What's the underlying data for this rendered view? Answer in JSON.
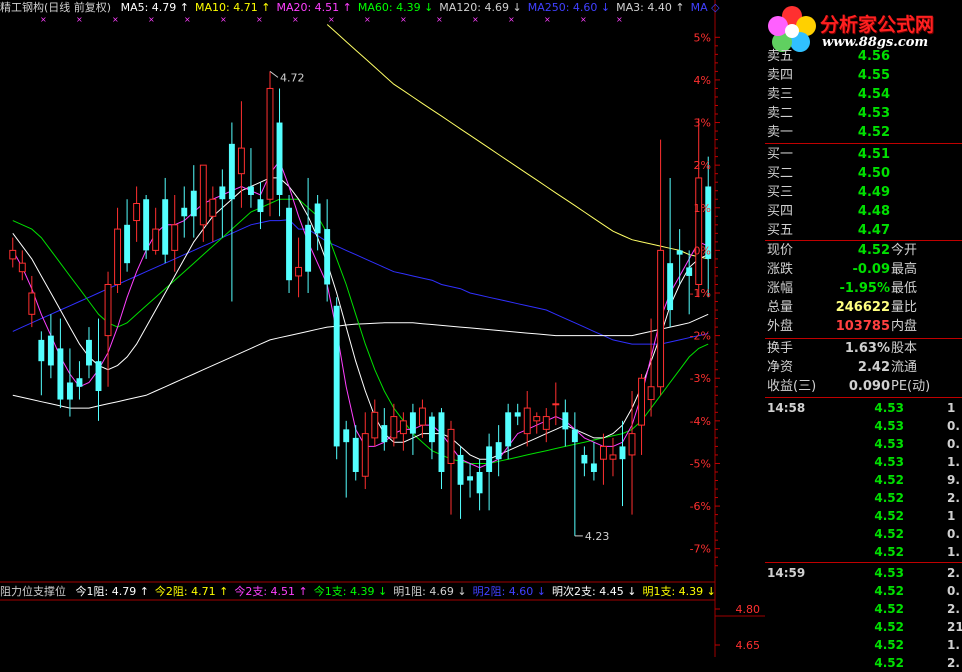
{
  "header": {
    "title": "精工钢构(日线 前复权)",
    "ma": [
      {
        "label": "MA5: 4.79",
        "arrow": "↑",
        "color": "#ffffff"
      },
      {
        "label": "MA10: 4.71",
        "arrow": "↑",
        "color": "#ffff00"
      },
      {
        "label": "MA20: 4.51",
        "arrow": "↑",
        "color": "#ff40ff"
      },
      {
        "label": "MA60: 4.39",
        "arrow": "↓",
        "color": "#00ff00"
      },
      {
        "label": "MA120: 4.69",
        "arrow": "↓",
        "color": "#d0d0d0"
      },
      {
        "label": "MA250: 4.60",
        "arrow": "↓",
        "color": "#4040ff"
      },
      {
        "label": "MA3: 4.40",
        "arrow": "↑",
        "color": "#d0d0d0"
      },
      {
        "label": "MA",
        "arrow": "◇",
        "color": "#4040ff"
      }
    ]
  },
  "price_axis": [
    "5%",
    "4%",
    "3%",
    "2%",
    "1%",
    "0%",
    "-1%",
    "-2%",
    "-3%",
    "-4%",
    "-5%",
    "-6%",
    "-7%"
  ],
  "annotations": {
    "high": "4.72",
    "low": "4.23"
  },
  "sub_header": {
    "title": "阻力位支撑位",
    "items": [
      {
        "label": "今1阻: 4.79",
        "arrow": "↑",
        "color": "#ffffff"
      },
      {
        "label": "今2阻: 4.71",
        "arrow": "↑",
        "color": "#ffff00"
      },
      {
        "label": "今2支: 4.51",
        "arrow": "↑",
        "color": "#ff40ff"
      },
      {
        "label": "今1支: 4.39",
        "arrow": "↓",
        "color": "#00ff00"
      },
      {
        "label": "明1阻: 4.69",
        "arrow": "↓",
        "color": "#d0d0d0"
      },
      {
        "label": "明2阻: 4.60",
        "arrow": "↓",
        "color": "#4040ff"
      },
      {
        "label": "明次2支: 4.45",
        "arrow": "↓",
        "color": "#ffffff"
      },
      {
        "label": "明1支: 4.39",
        "arrow": "↓",
        "color": "#ffff00"
      }
    ]
  },
  "sub_axis": [
    "4.80",
    "4.65"
  ],
  "logo": {
    "text": "分析家公式网",
    "url": "www.88gs.com"
  },
  "quote": {
    "asks": [
      {
        "label": "卖五",
        "value": "4.56"
      },
      {
        "label": "卖四",
        "value": "4.55"
      },
      {
        "label": "卖三",
        "value": "4.54"
      },
      {
        "label": "卖二",
        "value": "4.53"
      },
      {
        "label": "卖一",
        "value": "4.52"
      }
    ],
    "bids": [
      {
        "label": "买一",
        "value": "4.51"
      },
      {
        "label": "买二",
        "value": "4.50"
      },
      {
        "label": "买三",
        "value": "4.49"
      },
      {
        "label": "买四",
        "value": "4.48"
      },
      {
        "label": "买五",
        "value": "4.47"
      }
    ],
    "stats": [
      {
        "label": "现价",
        "value": "4.52",
        "label2": "今开",
        "color": "#00e000"
      },
      {
        "label": "涨跌",
        "value": "-0.09",
        "label2": "最高",
        "color": "#00e000"
      },
      {
        "label": "涨幅",
        "value": "-1.95%",
        "label2": "最低",
        "color": "#00e000"
      },
      {
        "label": "总量",
        "value": "246622",
        "label2": "量比",
        "color": "#ffff80"
      },
      {
        "label": "外盘",
        "value": "103785",
        "label2": "内盘",
        "color": "#ff4040"
      }
    ],
    "stats2": [
      {
        "label": "换手",
        "value": "1.63%",
        "label2": "股本",
        "color": "#d0d0d0"
      },
      {
        "label": "净资",
        "value": "2.42",
        "label2": "流通",
        "color": "#d0d0d0"
      },
      {
        "label": "收益(三)",
        "value": "0.090",
        "label2": "PE(动)",
        "color": "#d0d0d0"
      }
    ]
  },
  "ticks": [
    {
      "time": "14:58",
      "price": "4.53",
      "vol": "1"
    },
    {
      "time": "",
      "price": "4.53",
      "vol": "0."
    },
    {
      "time": "",
      "price": "4.53",
      "vol": "0."
    },
    {
      "time": "",
      "price": "4.53",
      "vol": "1."
    },
    {
      "time": "",
      "price": "4.52",
      "vol": "9."
    },
    {
      "time": "",
      "price": "4.52",
      "vol": "2."
    },
    {
      "time": "",
      "price": "4.52",
      "vol": "1"
    },
    {
      "time": "",
      "price": "4.52",
      "vol": "0."
    },
    {
      "time": "",
      "price": "4.52",
      "vol": "1."
    },
    {
      "time": "14:59",
      "price": "4.53",
      "vol": "2."
    },
    {
      "time": "",
      "price": "4.52",
      "vol": "0."
    },
    {
      "time": "",
      "price": "4.52",
      "vol": "2."
    },
    {
      "time": "",
      "price": "4.52",
      "vol": "21."
    },
    {
      "time": "",
      "price": "4.52",
      "vol": "1."
    },
    {
      "time": "",
      "price": "4.52",
      "vol": "2."
    }
  ],
  "chart_data": {
    "type": "candlestick",
    "y_unit": "%",
    "ylim": [
      -7.5,
      5.5
    ],
    "candles": [
      {
        "o": -0.2,
        "c": 0.0,
        "h": 0.3,
        "l": -0.4
      },
      {
        "o": -0.5,
        "c": -0.3,
        "h": 0.0,
        "l": -0.7
      },
      {
        "o": -1.5,
        "c": -1.0,
        "h": -0.6,
        "l": -1.8
      },
      {
        "o": -2.1,
        "c": -2.6,
        "h": -1.9,
        "l": -3.4
      },
      {
        "o": -2.0,
        "c": -2.7,
        "h": -1.5,
        "l": -3.0
      },
      {
        "o": -2.3,
        "c": -3.5,
        "h": -1.6,
        "l": -3.7
      },
      {
        "o": -3.1,
        "c": -3.5,
        "h": -2.3,
        "l": -3.9
      },
      {
        "o": -3.0,
        "c": -3.2,
        "h": -2.6,
        "l": -3.5
      },
      {
        "o": -2.1,
        "c": -2.7,
        "h": -1.8,
        "l": -3.0
      },
      {
        "o": -2.6,
        "c": -3.3,
        "h": -1.6,
        "l": -4.0
      },
      {
        "o": -2.0,
        "c": -0.8,
        "h": -0.5,
        "l": -3.2
      },
      {
        "o": -0.8,
        "c": 0.5,
        "h": 1.0,
        "l": -1.0
      },
      {
        "o": 0.6,
        "c": -0.3,
        "h": 1.2,
        "l": -0.5
      },
      {
        "o": 0.7,
        "c": 1.1,
        "h": 1.5,
        "l": 0.2
      },
      {
        "o": 1.2,
        "c": 0.0,
        "h": 1.3,
        "l": -0.2
      },
      {
        "o": 0.0,
        "c": 0.5,
        "h": 1.0,
        "l": -0.1
      },
      {
        "o": 1.2,
        "c": -0.1,
        "h": 1.7,
        "l": -0.3
      },
      {
        "o": 0.0,
        "c": 0.6,
        "h": 1.3,
        "l": -0.5
      },
      {
        "o": 1.0,
        "c": 0.8,
        "h": 1.5,
        "l": 0.3
      },
      {
        "o": 1.4,
        "c": 0.8,
        "h": 2.0,
        "l": 0.3
      },
      {
        "o": 0.6,
        "c": 2.0,
        "h": 2.0,
        "l": 0.2
      },
      {
        "o": 0.8,
        "c": 1.2,
        "h": 1.5,
        "l": 0.2
      },
      {
        "o": 1.5,
        "c": 1.2,
        "h": 1.9,
        "l": 0.3
      },
      {
        "o": 2.5,
        "c": 1.2,
        "h": 3.0,
        "l": -1.2
      },
      {
        "o": 1.8,
        "c": 2.4,
        "h": 3.5,
        "l": 1.0
      },
      {
        "o": 1.5,
        "c": 1.3,
        "h": 2.4,
        "l": 1.0
      },
      {
        "o": 1.2,
        "c": 0.9,
        "h": 1.6,
        "l": 0.5
      },
      {
        "o": 1.2,
        "c": 3.8,
        "h": 4.2,
        "l": 0.8
      },
      {
        "o": 3.0,
        "c": 1.3,
        "h": 3.8,
        "l": 0.8
      },
      {
        "o": 1.0,
        "c": -0.7,
        "h": 1.3,
        "l": -1.0
      },
      {
        "o": -0.6,
        "c": -0.4,
        "h": 0.3,
        "l": -1.1
      },
      {
        "o": 0.6,
        "c": -0.5,
        "h": 1.7,
        "l": -1.0
      },
      {
        "o": 1.1,
        "c": 0.4,
        "h": 1.3,
        "l": 0.0
      },
      {
        "o": 0.5,
        "c": -0.8,
        "h": 1.2,
        "l": -1.2
      },
      {
        "o": -1.3,
        "c": -4.6,
        "h": -1.1,
        "l": -4.9
      },
      {
        "o": -4.2,
        "c": -4.5,
        "h": -4.0,
        "l": -5.8
      },
      {
        "o": -4.4,
        "c": -5.2,
        "h": -4.1,
        "l": -5.4
      },
      {
        "o": -5.3,
        "c": -4.3,
        "h": -3.8,
        "l": -5.6
      },
      {
        "o": -4.4,
        "c": -3.8,
        "h": -3.5,
        "l": -4.6
      },
      {
        "o": -4.1,
        "c": -4.5,
        "h": -3.7,
        "l": -4.7
      },
      {
        "o": -4.4,
        "c": -3.9,
        "h": -3.6,
        "l": -4.6
      },
      {
        "o": -4.3,
        "c": -4.0,
        "h": -3.8,
        "l": -4.7
      },
      {
        "o": -3.8,
        "c": -4.3,
        "h": -3.6,
        "l": -4.8
      },
      {
        "o": -4.1,
        "c": -3.7,
        "h": -3.5,
        "l": -4.4
      },
      {
        "o": -3.9,
        "c": -4.5,
        "h": -3.8,
        "l": -4.9
      },
      {
        "o": -3.8,
        "c": -5.2,
        "h": -3.7,
        "l": -5.6
      },
      {
        "o": -5.0,
        "c": -4.2,
        "h": -4.0,
        "l": -6.2
      },
      {
        "o": -4.8,
        "c": -5.5,
        "h": -4.6,
        "l": -6.3
      },
      {
        "o": -5.3,
        "c": -5.4,
        "h": -5.0,
        "l": -5.8
      },
      {
        "o": -5.2,
        "c": -5.7,
        "h": -4.9,
        "l": -6.1
      },
      {
        "o": -4.6,
        "c": -5.2,
        "h": -4.3,
        "l": -6.1
      },
      {
        "o": -4.5,
        "c": -4.9,
        "h": -4.1,
        "l": -5.3
      },
      {
        "o": -3.8,
        "c": -4.6,
        "h": -3.6,
        "l": -4.9
      },
      {
        "o": -3.8,
        "c": -3.9,
        "h": -3.6,
        "l": -4.1
      },
      {
        "o": -4.3,
        "c": -3.7,
        "h": -3.3,
        "l": -4.6
      },
      {
        "o": -4.0,
        "c": -3.9,
        "h": -3.8,
        "l": -4.3
      },
      {
        "o": -4.2,
        "c": -3.9,
        "h": -3.7,
        "l": -4.5
      },
      {
        "o": -3.6,
        "c": -3.6,
        "h": -3.1,
        "l": -4.1
      },
      {
        "o": -3.8,
        "c": -4.2,
        "h": -3.5,
        "l": -4.6
      },
      {
        "o": -4.2,
        "c": -4.5,
        "h": -3.8,
        "l": -6.7
      },
      {
        "o": -4.8,
        "c": -5.0,
        "h": -4.6,
        "l": -5.3
      },
      {
        "o": -5.0,
        "c": -5.2,
        "h": -4.5,
        "l": -5.4
      },
      {
        "o": -4.9,
        "c": -4.6,
        "h": -4.3,
        "l": -5.5
      },
      {
        "o": -4.9,
        "c": -4.8,
        "h": -4.4,
        "l": -5.3
      },
      {
        "o": -4.6,
        "c": -4.9,
        "h": -4.0,
        "l": -6.0
      },
      {
        "o": -4.8,
        "c": -4.3,
        "h": -3.3,
        "l": -6.2
      },
      {
        "o": -4.1,
        "c": -3.0,
        "h": -2.9,
        "l": -4.8
      },
      {
        "o": -3.5,
        "c": -3.2,
        "h": -1.6,
        "l": -3.9
      },
      {
        "o": -3.2,
        "c": 0.0,
        "h": 2.6,
        "l": -3.4
      },
      {
        "o": -0.3,
        "c": -1.4,
        "h": 1.7,
        "l": -1.8
      },
      {
        "o": 0.0,
        "c": -0.1,
        "h": 0.5,
        "l": -0.8
      },
      {
        "o": -0.4,
        "c": -0.6,
        "h": 0.0,
        "l": -1.5
      },
      {
        "o": -0.8,
        "c": 1.7,
        "h": 3.1,
        "l": -1.1
      },
      {
        "o": 1.5,
        "c": -0.2,
        "h": 2.2,
        "l": -1.1
      }
    ],
    "lines": [
      {
        "name": "MA250",
        "color": "#3030ff",
        "values": [
          -1.9,
          -1.8,
          -1.7,
          -1.6,
          -1.5,
          -1.4,
          -1.3,
          -1.2,
          -1.1,
          -1.0,
          -0.9,
          -0.8,
          -0.7,
          -0.6,
          -0.5,
          -0.4,
          -0.3,
          -0.2,
          -0.1,
          0.0,
          0.1,
          0.2,
          0.3,
          0.4,
          0.5,
          0.6,
          0.65,
          0.7,
          0.7,
          0.72,
          0.5,
          0.5,
          0.35,
          0.2,
          0.1,
          0.0,
          -0.1,
          -0.2,
          -0.3,
          -0.4,
          -0.5,
          -0.55,
          -0.6,
          -0.65,
          -0.7,
          -0.8,
          -0.85,
          -0.9,
          -1.0,
          -1.05,
          -1.1,
          -1.15,
          -1.2,
          -1.25,
          -1.3,
          -1.35,
          -1.4,
          -1.5,
          -1.6,
          -1.7,
          -1.8,
          -1.9,
          -2.0,
          -2.1,
          -2.15,
          -2.2,
          -2.2,
          -2.2,
          -2.2,
          -2.15,
          -2.1,
          -2.05,
          -2.0,
          -1.95
        ]
      },
      {
        "name": "MA120",
        "color": "#ffff66",
        "values": [
          null,
          null,
          null,
          null,
          null,
          null,
          null,
          null,
          null,
          null,
          null,
          null,
          null,
          null,
          null,
          null,
          null,
          null,
          null,
          null,
          null,
          null,
          null,
          null,
          null,
          null,
          null,
          null,
          null,
          null,
          null,
          null,
          null,
          5.3,
          5.1,
          4.9,
          4.7,
          4.5,
          4.3,
          4.1,
          3.9,
          3.75,
          3.6,
          3.45,
          3.3,
          3.15,
          3.0,
          2.85,
          2.7,
          2.55,
          2.4,
          2.25,
          2.1,
          1.95,
          1.8,
          1.65,
          1.5,
          1.35,
          1.2,
          1.05,
          0.9,
          0.75,
          0.6,
          0.45,
          0.35,
          0.25,
          0.2,
          0.15,
          0.1,
          0.05,
          0.0,
          -0.1,
          -0.15,
          -0.2
        ]
      },
      {
        "name": "MA60",
        "color": "#ffffff",
        "values": [
          -3.4,
          -3.45,
          -3.5,
          -3.55,
          -3.6,
          -3.65,
          -3.7,
          -3.7,
          -3.7,
          -3.65,
          -3.6,
          -3.55,
          -3.5,
          -3.45,
          -3.4,
          -3.3,
          -3.2,
          -3.1,
          -3.0,
          -2.9,
          -2.8,
          -2.7,
          -2.6,
          -2.5,
          -2.4,
          -2.3,
          -2.2,
          -2.1,
          -2.05,
          -2.0,
          -1.95,
          -1.9,
          -1.85,
          -1.8,
          -1.78,
          -1.75,
          -1.73,
          -1.72,
          -1.71,
          -1.7,
          -1.7,
          -1.7,
          -1.7,
          -1.72,
          -1.74,
          -1.76,
          -1.78,
          -1.8,
          -1.82,
          -1.84,
          -1.86,
          -1.88,
          -1.9,
          -1.92,
          -1.94,
          -1.96,
          -1.98,
          -2.0,
          -2.0,
          -2.0,
          -2.0,
          -2.0,
          -2.0,
          -2.0,
          -2.0,
          -2.0,
          -1.95,
          -1.9,
          -1.85,
          -1.8,
          -1.75,
          -1.7,
          -1.6,
          -1.5
        ]
      },
      {
        "name": "MA30",
        "color": "#00e000",
        "values": [
          0.7,
          0.6,
          0.5,
          0.3,
          0.0,
          -0.3,
          -0.6,
          -0.9,
          -1.2,
          -1.5,
          -1.7,
          -1.8,
          -1.7,
          -1.5,
          -1.3,
          -1.1,
          -0.9,
          -0.7,
          -0.5,
          -0.3,
          -0.1,
          0.1,
          0.3,
          0.5,
          0.7,
          0.9,
          1.0,
          1.1,
          1.2,
          1.2,
          1.2,
          1.0,
          0.8,
          0.4,
          -0.2,
          -0.8,
          -1.5,
          -2.2,
          -2.8,
          -3.3,
          -3.7,
          -4.0,
          -4.3,
          -4.5,
          -4.7,
          -4.8,
          -4.9,
          -4.95,
          -5.0,
          -5.0,
          -5.0,
          -4.95,
          -4.9,
          -4.85,
          -4.8,
          -4.75,
          -4.7,
          -4.65,
          -4.6,
          -4.55,
          -4.5,
          -4.45,
          -4.4,
          -4.35,
          -4.3,
          -4.2,
          -4.0,
          -3.7,
          -3.4,
          -3.1,
          -2.8,
          -2.5,
          -2.3,
          -2.2
        ]
      },
      {
        "name": "MA10",
        "color": "#ffffff",
        "values": [
          0.4,
          0.1,
          -0.2,
          -0.6,
          -1.0,
          -1.4,
          -1.8,
          -2.2,
          -2.5,
          -2.7,
          -2.8,
          -2.7,
          -2.5,
          -2.2,
          -1.8,
          -1.4,
          -1.0,
          -0.6,
          -0.2,
          0.2,
          0.5,
          0.8,
          1.0,
          1.2,
          1.4,
          1.5,
          1.6,
          1.7,
          1.7,
          1.5,
          1.2,
          0.8,
          0.3,
          -0.3,
          -1.0,
          -1.8,
          -2.6,
          -3.3,
          -3.9,
          -4.3,
          -4.5,
          -4.5,
          -4.4,
          -4.3,
          -4.3,
          -4.3,
          -4.4,
          -4.6,
          -4.8,
          -4.9,
          -4.9,
          -4.8,
          -4.7,
          -4.6,
          -4.5,
          -4.4,
          -4.3,
          -4.2,
          -4.1,
          -4.2,
          -4.3,
          -4.4,
          -4.4,
          -4.3,
          -4.1,
          -3.7,
          -3.2,
          -2.6,
          -2.0,
          -1.3,
          -0.8,
          -0.4,
          -0.2,
          -0.1
        ]
      },
      {
        "name": "MA5",
        "color": "#ff40ff",
        "values": [
          0.0,
          -0.4,
          -0.9,
          -1.5,
          -2.0,
          -2.5,
          -2.9,
          -3.2,
          -3.1,
          -2.8,
          -2.4,
          -1.8,
          -1.1,
          -0.5,
          0.0,
          0.4,
          0.6,
          0.6,
          0.7,
          0.9,
          1.1,
          1.2,
          1.3,
          1.4,
          1.5,
          1.4,
          1.3,
          1.8,
          2.1,
          1.5,
          0.8,
          0.2,
          -0.3,
          -0.8,
          -1.9,
          -3.2,
          -4.2,
          -4.6,
          -4.6,
          -4.5,
          -4.3,
          -4.2,
          -4.2,
          -4.1,
          -4.1,
          -4.3,
          -4.6,
          -4.9,
          -5.0,
          -5.1,
          -5.0,
          -4.9,
          -4.6,
          -4.3,
          -4.2,
          -4.1,
          -4.0,
          -3.9,
          -4.0,
          -4.2,
          -4.4,
          -4.5,
          -4.6,
          -4.6,
          -4.5,
          -4.1,
          -3.4,
          -2.5,
          -1.6,
          -1.0,
          -0.6,
          -0.2,
          0.2,
          0.1
        ]
      }
    ]
  }
}
